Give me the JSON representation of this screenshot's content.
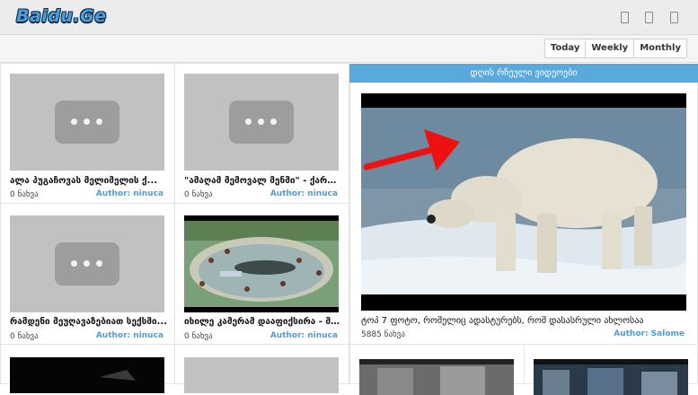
{
  "header": {
    "logo": "Baidu.Ge",
    "icons": [
      "device-icon-1",
      "device-icon-2",
      "device-icon-3"
    ]
  },
  "tabs": [
    "Today",
    "Weekly",
    "Monthly"
  ],
  "cards": [
    {
      "title": "ალა პუგაჩოვას მელიმელის ქ...",
      "views": "0 ნახვა",
      "author": "Author: ninuca"
    },
    {
      "title": "\"ამაღამ მემოვალ მენმი\" - ქართ...",
      "views": "0 ნახვა",
      "author": "Author: ninuca"
    },
    {
      "title": "რამდენი მეუღავაზებიათ სექსმი...",
      "views": "0 ნახვა",
      "author": "Author: ninuca"
    },
    {
      "title": "იხილე კამერამ დააფიქსირა - მა...",
      "views": "0 ნახვა",
      "author": "Author: ninuca"
    }
  ],
  "featured": {
    "header": "დღის რჩეული ვიდეოები",
    "title": "ტოპ 7 ფოტო, რომელიც ადასტურებს, რომ დასასრული ახლოსაა",
    "views": "5885 ნახვა",
    "author": "Author: Salome"
  },
  "colors": {
    "accent": "#5aa9de",
    "author": "#4a9fd9"
  }
}
